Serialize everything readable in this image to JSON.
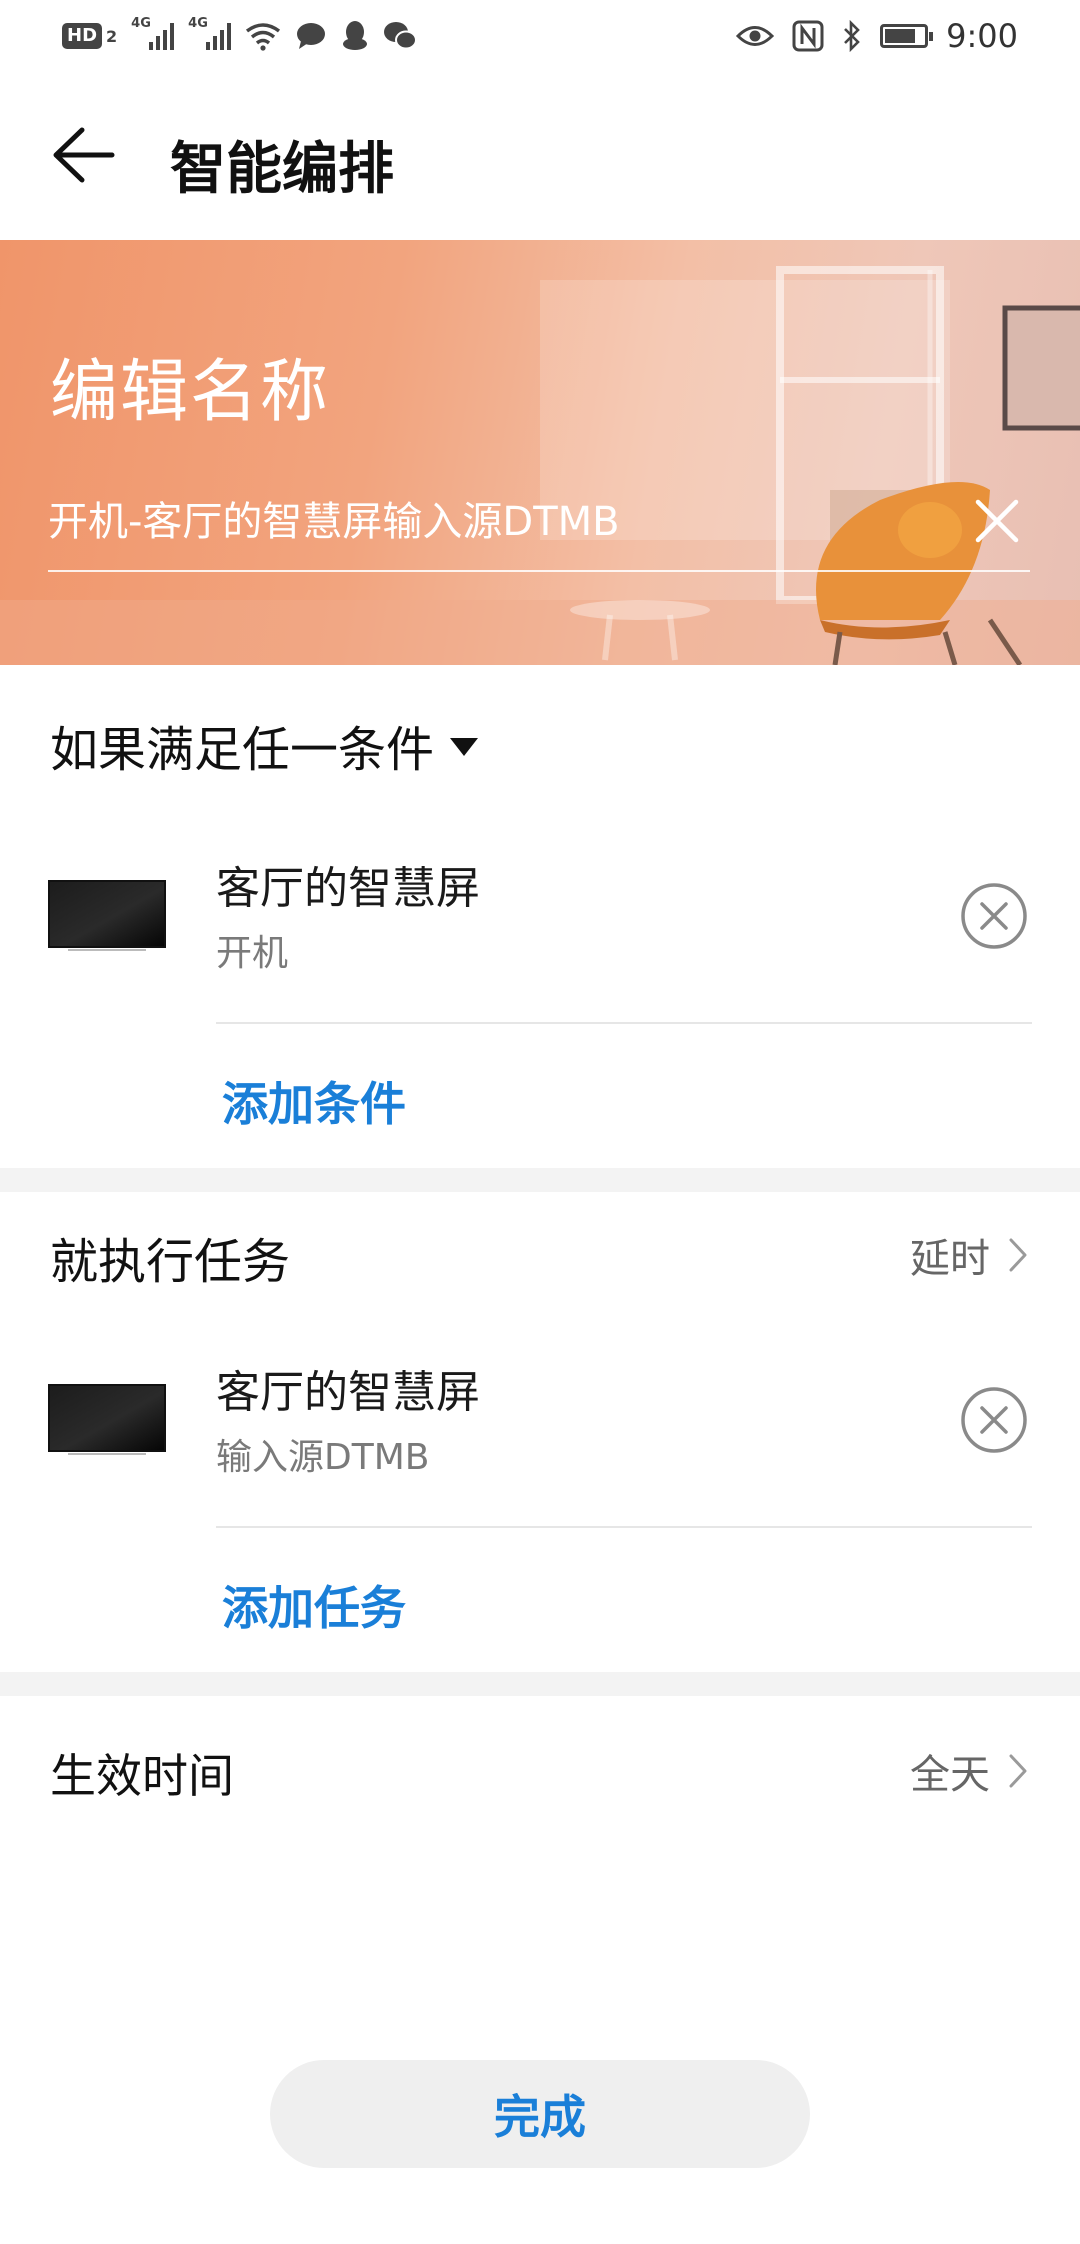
{
  "status_bar": {
    "hd_label": "HD",
    "hd_sub": "2",
    "signal1_label": "4G",
    "signal2_label": "4G",
    "icons": [
      "wifi-icon",
      "message-icon",
      "qq-icon",
      "wechat-icon",
      "eye-comfort-icon",
      "nfc-icon",
      "bluetooth-icon",
      "battery-icon"
    ],
    "time": "9:00"
  },
  "header": {
    "title": "智能编排",
    "back_icon": "arrow-left-icon"
  },
  "banner": {
    "title": "编辑名称",
    "name_value": "开机-客厅的智慧屏输入源DTMB",
    "clear_icon": "close-icon"
  },
  "conditions": {
    "title": "如果满足任一条件",
    "items": [
      {
        "device": "客厅的智慧屏",
        "state": "开机"
      }
    ],
    "add_label": "添加条件"
  },
  "tasks": {
    "title": "就执行任务",
    "delay_label": "延时",
    "items": [
      {
        "device": "客厅的智慧屏",
        "state": "输入源DTMB"
      }
    ],
    "add_label": "添加任务"
  },
  "effective_time": {
    "label": "生效时间",
    "value": "全天"
  },
  "footer": {
    "done_label": "完成"
  },
  "colors": {
    "accent": "#1a7fd8",
    "banner_start": "#f0956a",
    "banner_end": "#e8bfb3"
  }
}
